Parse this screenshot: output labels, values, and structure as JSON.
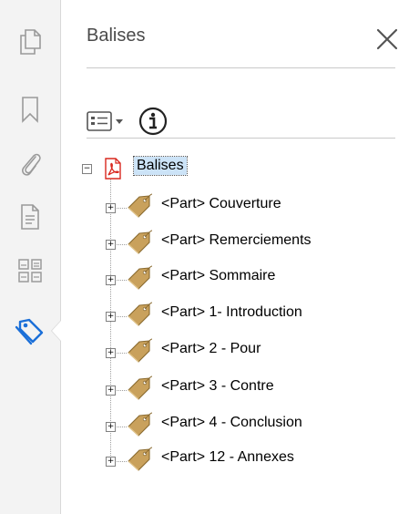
{
  "panel": {
    "title": "Balises"
  },
  "toolbar": {
    "icons": [
      "options-menu-icon",
      "info-icon"
    ]
  },
  "rail": {
    "icons": [
      "page-thumbnails-icon",
      "bookmarks-icon",
      "attachments-icon",
      "document-icon",
      "content-order-icon",
      "tags-icon"
    ],
    "active": "tags-icon"
  },
  "tree": {
    "root": {
      "label": "Balises",
      "toggle": "−"
    },
    "items": [
      {
        "label": "<Part> Couverture",
        "toggle": "+"
      },
      {
        "label": "<Part> Remerciements",
        "toggle": "+"
      },
      {
        "label": "<Part> Sommaire",
        "toggle": "+"
      },
      {
        "label": "<Part> 1- Introduction",
        "toggle": "+"
      },
      {
        "label": "<Part> 2 - Pour",
        "toggle": "+"
      },
      {
        "label": "<Part> 3 - Contre",
        "toggle": "+"
      },
      {
        "label": "<Part> 4 - Conclusion",
        "toggle": "+"
      },
      {
        "label": "<Part> 12 - Annexes",
        "toggle": "+"
      }
    ]
  },
  "colors": {
    "accent": "#1b6fd8",
    "icon_gray": "#9a9a9a",
    "tag_brown": "#c9a15c",
    "pdf_red": "#d9281f"
  }
}
